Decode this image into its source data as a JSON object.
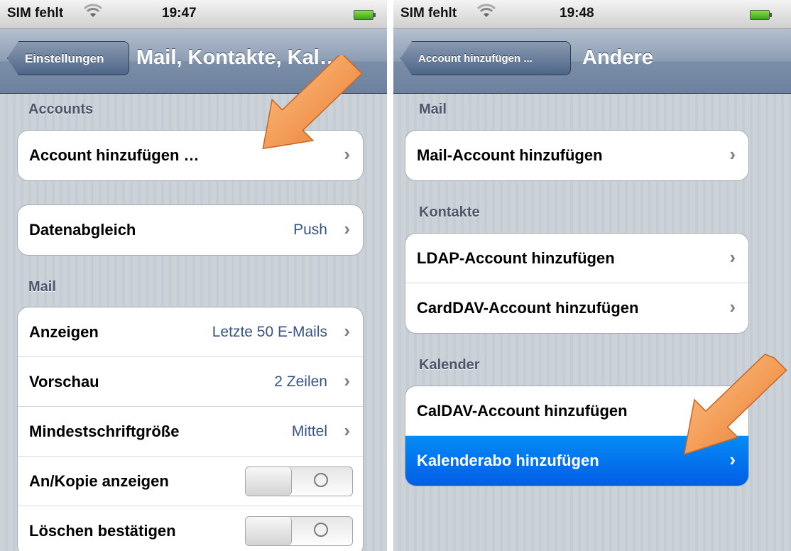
{
  "left": {
    "status": {
      "carrier": "SIM fehlt",
      "time": "19:47"
    },
    "nav": {
      "back": "Einstellungen",
      "title": "Mail, Kontakte, Kal…"
    },
    "sections": {
      "accounts": "Accounts",
      "mail": "Mail"
    },
    "rows": {
      "add_account": {
        "label": "Account hinzufügen …"
      },
      "fetch": {
        "label": "Datenabgleich",
        "value": "Push"
      },
      "show": {
        "label": "Anzeigen",
        "value": "Letzte 50 E-Mails"
      },
      "preview": {
        "label": "Vorschau",
        "value": "2 Zeilen"
      },
      "font_size": {
        "label": "Mindestschriftgröße",
        "value": "Mittel"
      },
      "cc": {
        "label": "An/Kopie anzeigen",
        "state": "off"
      },
      "confirm_delete": {
        "label": "Löschen bestätigen",
        "state": "off"
      }
    }
  },
  "right": {
    "status": {
      "carrier": "SIM fehlt",
      "time": "19:48"
    },
    "nav": {
      "back": "Account hinzufügen ...",
      "title": "Andere"
    },
    "sections": {
      "mail": "Mail",
      "contacts": "Kontakte",
      "calendar": "Kalender"
    },
    "rows": {
      "mail_account": {
        "label": "Mail-Account hinzufügen"
      },
      "ldap": {
        "label": "LDAP-Account hinzufügen"
      },
      "carddav": {
        "label": "CardDAV-Account hinzufügen"
      },
      "caldav": {
        "label": "CalDAV-Account hinzufügen"
      },
      "subscription": {
        "label": "Kalenderabo hinzufügen"
      }
    }
  },
  "colors": {
    "accent_arrow": "#f0883a",
    "selected_row": "#0a6ff0",
    "value_text": "#385487"
  },
  "icons": [
    "wifi-icon",
    "battery-icon",
    "chevron-right-icon",
    "arrow-pointer-icon"
  ]
}
